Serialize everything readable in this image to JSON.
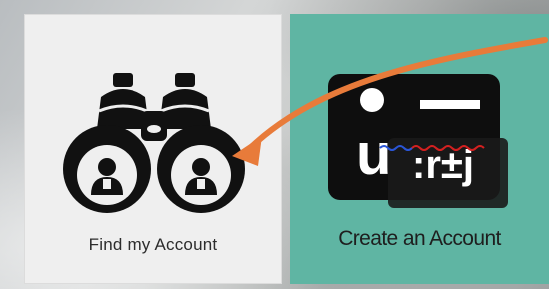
{
  "tiles": [
    {
      "label": "Find my Account",
      "icon": "binoculars-icon",
      "background": "#efefef"
    },
    {
      "label": "Create an Account",
      "icon": "id-card-icon",
      "background": "#5fb5a3"
    }
  ],
  "accent": {
    "arrow": "#e87b3a",
    "squiggle_red": "#d42020",
    "squiggle_blue": "#2a55d6"
  },
  "icon_text": {
    "mark": "u",
    "fragment": ":r±j"
  }
}
